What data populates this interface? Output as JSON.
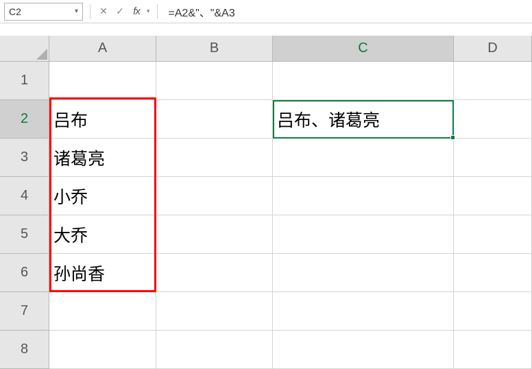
{
  "name_box": "C2",
  "formula": "=A2&\"、\"&A3",
  "columns": [
    {
      "label": "A",
      "active": false
    },
    {
      "label": "B",
      "active": false
    },
    {
      "label": "C",
      "active": true
    },
    {
      "label": "D",
      "active": false
    }
  ],
  "rows": [
    {
      "label": "1",
      "active": false
    },
    {
      "label": "2",
      "active": true
    },
    {
      "label": "3",
      "active": false
    },
    {
      "label": "4",
      "active": false
    },
    {
      "label": "5",
      "active": false
    },
    {
      "label": "6",
      "active": false
    },
    {
      "label": "7",
      "active": false
    },
    {
      "label": "8",
      "active": false
    }
  ],
  "cells": {
    "A2": "吕布",
    "A3": "诸葛亮",
    "A4": "小乔",
    "A5": "大乔",
    "A6": "孙尚香",
    "C2": "吕布、诸葛亮"
  },
  "active_cell": "C2"
}
